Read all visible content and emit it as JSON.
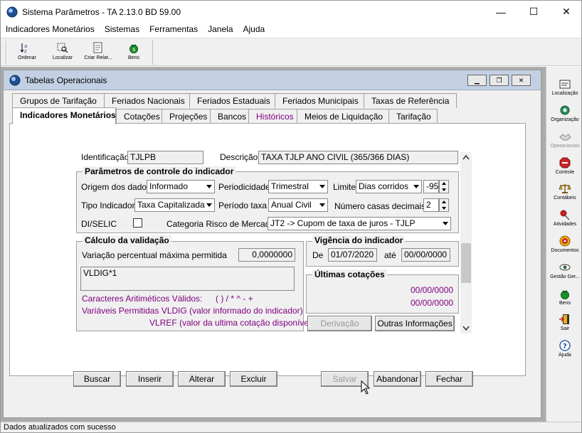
{
  "app": {
    "title": "Sistema Parâmetros -  TA 2.13.0 BD 59.00",
    "minimize": "—",
    "maximize": "☐",
    "close": "✕"
  },
  "menu": [
    "Indicadores Monetários",
    "Sistemas",
    "Ferramentas",
    "Janela",
    "Ajuda"
  ],
  "toolbar": {
    "ordenar": "Ordenar",
    "localizar": "Localizar",
    "criar_relat": "Criar Relat...",
    "bens": "Bens"
  },
  "rightbar": {
    "localizacao": "Localização",
    "organizacao": "Organização",
    "operacionais": "Operacionais",
    "controle": "Controle",
    "contabeis": "Contábeis",
    "atividades": "Atividades",
    "documentos": "Documentos",
    "gestao": "Gestão Ger...",
    "bens": "Bens",
    "sair": "Sair",
    "ajuda": "Ajuda"
  },
  "child": {
    "title": "Tabelas Operacionais",
    "btn_min": "▁",
    "btn_max": "❐",
    "btn_close": "✕"
  },
  "tabs_row1": [
    "Grupos de Tarifação",
    "Feriados Nacionais",
    "Feriados Estaduais",
    "Feriados Municipais",
    "Taxas de Referência"
  ],
  "tabs_row2": [
    "Indicadores Monetários",
    "Cotações",
    "Projeções",
    "Bancos",
    "Históricos",
    "Meios de Liquidação",
    "Tarifação"
  ],
  "form": {
    "identificacao_label": "Identificação",
    "identificacao_value": "TJLPB",
    "descricao_label": "Descrição",
    "descricao_value": "TAXA TJLP ANO CIVIL (365/366 DIAS)",
    "params_title": "Parâmetros de controle do indicador",
    "origem_label": "Origem dos dados",
    "origem_value": "Informado",
    "periodicidade_label": "Periodicidade",
    "periodicidade_value": "Trimestral",
    "limite_label": "Limite",
    "limite_value": "Dias corridos",
    "limite_num": "-95",
    "tipo_label": "Tipo Indicador",
    "tipo_value": "Taxa Capitalizada",
    "periodo_label": "Período taxa",
    "periodo_value": "Anual Civil",
    "casas_label": "Número casas decimais",
    "casas_value": "2",
    "diselic_label": "DI/SELIC",
    "categoria_label": "Categoria Risco de Mercado",
    "categoria_value": "JT2 -> Cupom de taxa de juros - TJLP",
    "calc_title": "Cálculo da validação",
    "variacao_label": "Variação percentual máxima permitida",
    "variacao_value": "0,0000000",
    "formula": "VLDIG*1",
    "caracteres_label": "Caracteres Aritiméticos Válidos:",
    "caracteres_value": "( ) / * ^ - +",
    "variaveis_text": "Variáveis Permitidas VLDIG  (valor informado do indicador)",
    "vlref_text": "VLREF (valor da ultima cotação disponível)",
    "vigencia_title": "Vigência do indicador",
    "de_label": "De",
    "de_value": "01/07/2020",
    "ate_label": "até",
    "ate_value": "00/00/0000",
    "ultimas_title": "Últimas cotações",
    "cot1": "00/00/0000",
    "cot2": "00/00/0000",
    "derivacao_btn": "Derivação",
    "outras_btn": "Outras Informações"
  },
  "buttons": {
    "buscar": "Buscar",
    "inserir": "Inserir",
    "alterar": "Alterar",
    "excluir": "Excluir",
    "salvar": "Salvar",
    "abandonar": "Abandonar",
    "fechar": "Fechar"
  },
  "status": "Dados atualizados com sucesso",
  "colors": {
    "title_bar_child": "#c3d0e4",
    "purple_text": "#800080",
    "desktop": "#ababab"
  }
}
